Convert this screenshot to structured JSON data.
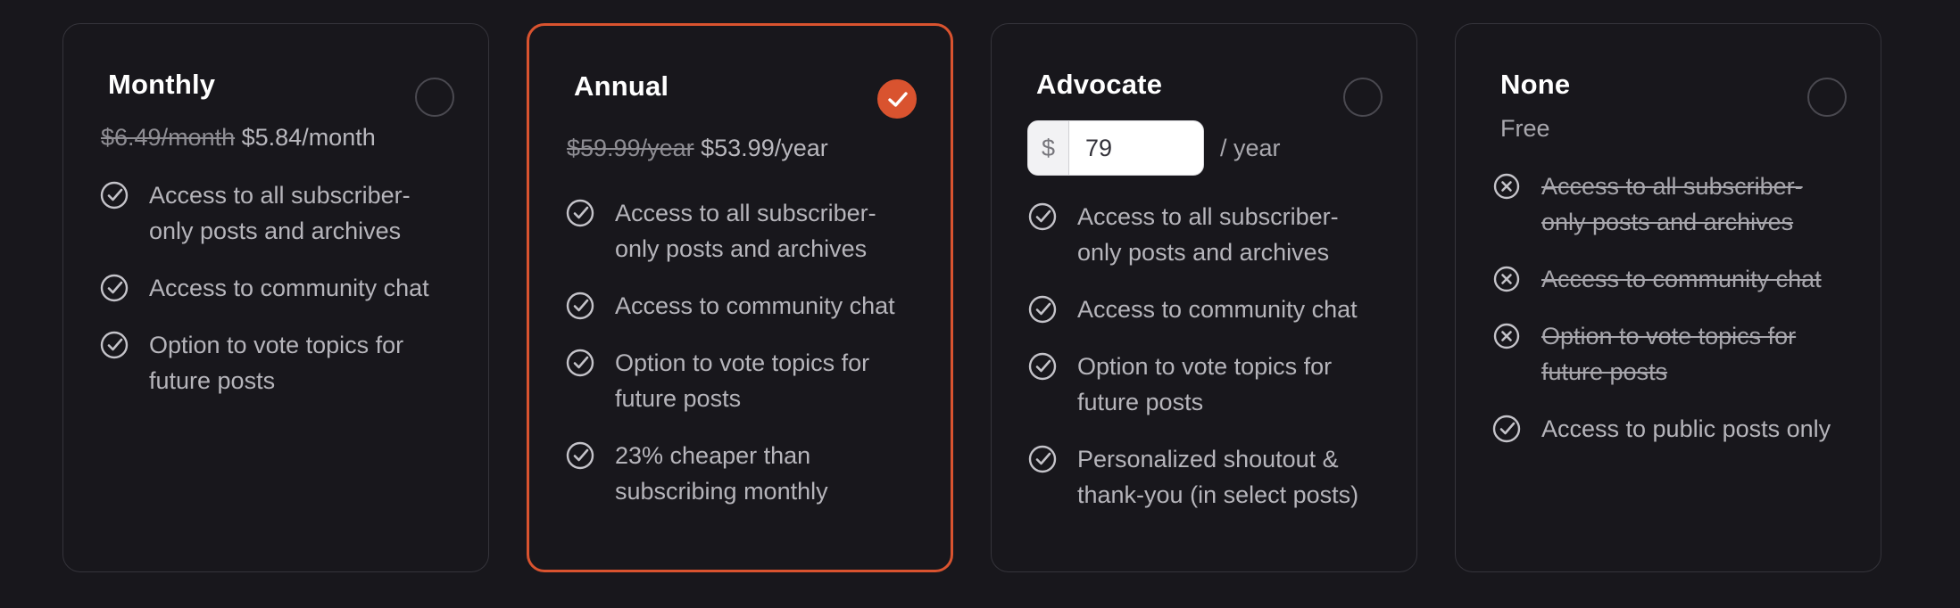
{
  "plans": [
    {
      "title": "Monthly",
      "price_old": "$6.49/month",
      "price_new": "$5.84/month",
      "selected": false,
      "features": [
        "Access to all subscriber-only posts and archives",
        "Access to community chat",
        "Option to vote topics for future posts"
      ]
    },
    {
      "title": "Annual",
      "price_old": "$59.99/year",
      "price_new": "$53.99/year",
      "selected": true,
      "features": [
        "Access to all subscriber-only posts and archives",
        "Access to community chat",
        "Option to vote topics for future posts",
        "23% cheaper than subscribing monthly"
      ]
    },
    {
      "title": "Advocate",
      "currency_symbol": "$",
      "amount_value": "79",
      "period_label": "/ year",
      "selected": false,
      "features": [
        "Access to all subscriber-only posts and archives",
        "Access to community chat",
        "Option to vote topics for future posts",
        "Personalized shoutout & thank-you (in select posts)"
      ]
    },
    {
      "title": "None",
      "subtitle": "Free",
      "selected": false,
      "features": [
        "Access to all subscriber-only posts and archives",
        "Access to community chat",
        "Option to vote topics for future posts",
        "Access to public posts only"
      ],
      "feature_icons": [
        "x-circle-icon",
        "x-circle-icon",
        "x-circle-icon",
        "check-circle-icon"
      ]
    }
  ],
  "colors": {
    "accent": "#d9532f",
    "background": "#18171c",
    "card_border": "#35343b",
    "title": "#ffffff",
    "muted_text": "#b6b5bb"
  }
}
